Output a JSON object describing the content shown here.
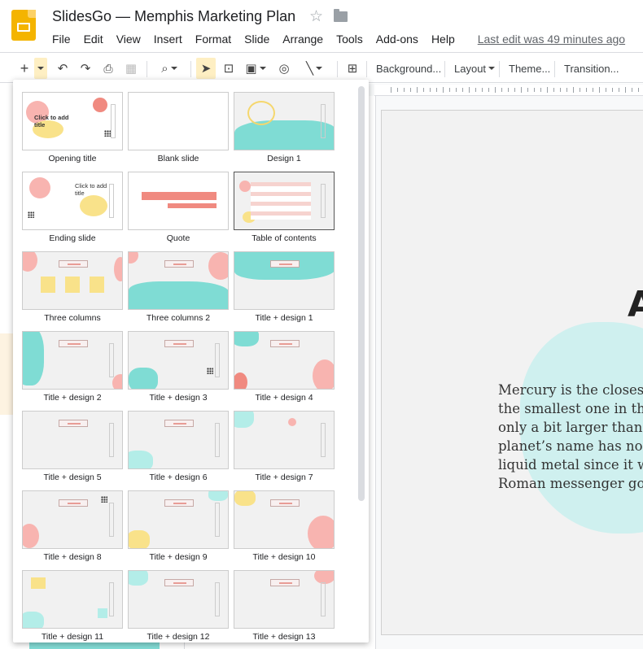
{
  "app": {
    "title": "SlidesGo — Memphis Marketing Plan"
  },
  "menu": {
    "items": [
      "File",
      "Edit",
      "View",
      "Insert",
      "Format",
      "Slide",
      "Arrange",
      "Tools",
      "Add-ons",
      "Help"
    ],
    "last_edit": "Last edit was 49 minutes ago"
  },
  "toolbar": {
    "background": "Background...",
    "layout": "Layout",
    "theme": "Theme...",
    "transition": "Transition..."
  },
  "layouts": [
    {
      "label": "Opening title",
      "selected": false
    },
    {
      "label": "Blank slide",
      "selected": false
    },
    {
      "label": "Design 1",
      "selected": false
    },
    {
      "label": "Ending slide",
      "selected": false
    },
    {
      "label": "Quote",
      "selected": false
    },
    {
      "label": "Table of contents",
      "selected": true
    },
    {
      "label": "Three columns",
      "selected": false
    },
    {
      "label": "Three columns 2",
      "selected": false
    },
    {
      "label": "Title + design 1",
      "selected": false
    },
    {
      "label": "Title + design 2",
      "selected": false
    },
    {
      "label": "Title + design 3",
      "selected": false
    },
    {
      "label": "Title + design 4",
      "selected": false
    },
    {
      "label": "Title + design 5",
      "selected": false
    },
    {
      "label": "Title + design 6",
      "selected": false
    },
    {
      "label": "Title + design 7",
      "selected": false
    },
    {
      "label": "Title + design 8",
      "selected": false
    },
    {
      "label": "Title + design 9",
      "selected": false
    },
    {
      "label": "Title + design 10",
      "selected": false
    },
    {
      "label": "Title + design 11",
      "selected": false
    },
    {
      "label": "Title + design 12",
      "selected": false
    },
    {
      "label": "Title + design 13",
      "selected": false
    }
  ],
  "thumb_text": {
    "click_to_add_title": "Click to add title"
  },
  "slide": {
    "title": "A",
    "body": [
      "Mercury is the closest",
      "the smallest one in the",
      "only a bit larger than",
      "planet’s name has noth",
      "liquid metal since it w",
      "Roman messenger god"
    ]
  },
  "colors": {
    "accent_teal": "#7fdcd4",
    "accent_pink": "#f8b4b0",
    "accent_yellow": "#f9e28a",
    "accent_coral": "#f08a80",
    "toolbar_active": "#feefc3",
    "app_yellow": "#f4b400"
  }
}
